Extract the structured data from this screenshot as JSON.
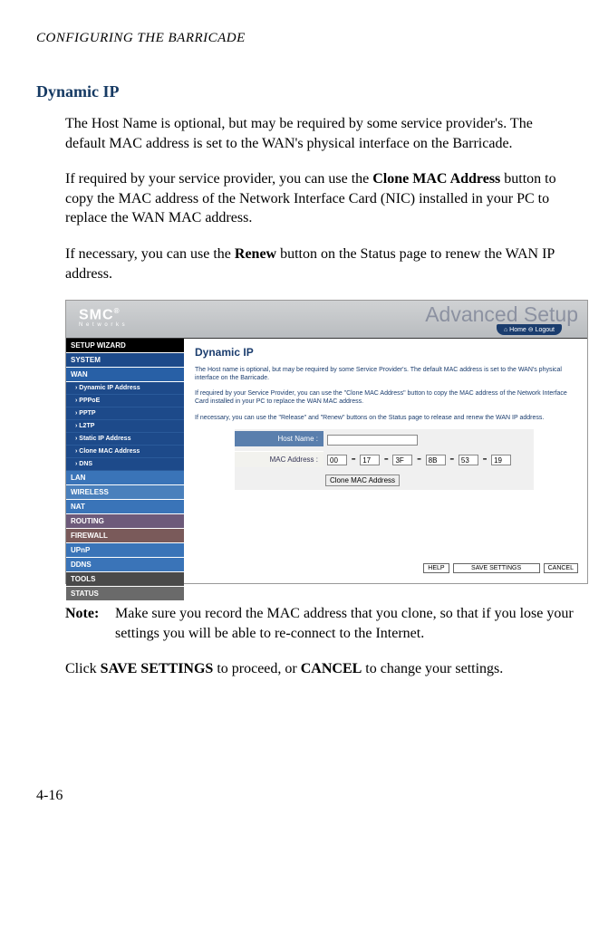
{
  "running_head": "CONFIGURING THE BARRICADE",
  "heading": "Dynamic IP",
  "para1": "The Host Name is optional, but may be required by some service provider's. The default MAC address is set to the WAN's physical interface on the Barricade.",
  "para2_a": "If required by your service provider, you can use the ",
  "para2_bold": "Clone MAC Address",
  "para2_b": " button to copy the MAC address of the Network Interface Card (NIC) installed in your PC to replace the WAN MAC address.",
  "para3_a": "If necessary, you can use the ",
  "para3_bold": "Renew",
  "para3_b": " button on the Status page to renew the WAN IP address.",
  "note_label": "Note:",
  "note_text": "Make sure you record the MAC address that you clone, so that if you lose your settings you will be able to re-connect to the Internet.",
  "para4_a": "Click ",
  "para4_bold1": "SAVE SETTINGS",
  "para4_b": " to proceed, or ",
  "para4_bold2": "CANCEL",
  "para4_c": " to change your settings.",
  "page_number": "4-16",
  "screenshot": {
    "logo": "SMC",
    "logo_reg": "®",
    "logo_sub": "N e t w o r k s",
    "adv": "Advanced Setup",
    "home_logout": "⌂ Home   ⊖ Logout",
    "sidebar": {
      "setup": "SETUP WIZARD",
      "system": "SYSTEM",
      "wan": "WAN",
      "wan_items": [
        "Dynamic IP Address",
        "PPPoE",
        "PPTP",
        "L2TP",
        "Static IP Address",
        "Clone MAC Address",
        "DNS"
      ],
      "lan": "LAN",
      "wireless": "WIRELESS",
      "nat": "NAT",
      "routing": "ROUTING",
      "firewall": "FIREWALL",
      "upnp": "UPnP",
      "ddns": "DDNS",
      "tools": "TOOLS",
      "status": "STATUS"
    },
    "main": {
      "title": "Dynamic IP",
      "desc1": "The Host name is optional, but may be required by some Service Provider's. The default MAC address is set to the WAN's physical interface on the Barricade.",
      "desc2": "If required by your Service Provider, you can use the \"Clone MAC Address\" button to copy the MAC address of the Network Interface Card installed in your PC to replace the WAN MAC address.",
      "desc3": "If necessary, you can use the \"Release\" and \"Renew\" buttons on the Status page to release and renew the WAN IP address.",
      "host_label": "Host Name :",
      "host_value": "",
      "mac_label": "MAC Address :",
      "mac": [
        "00",
        "17",
        "3F",
        "8B",
        "53",
        "19"
      ],
      "clone_btn": "Clone MAC Address",
      "help_btn": "HELP",
      "save_btn": "SAVE SETTINGS",
      "cancel_btn": "CANCEL"
    }
  }
}
